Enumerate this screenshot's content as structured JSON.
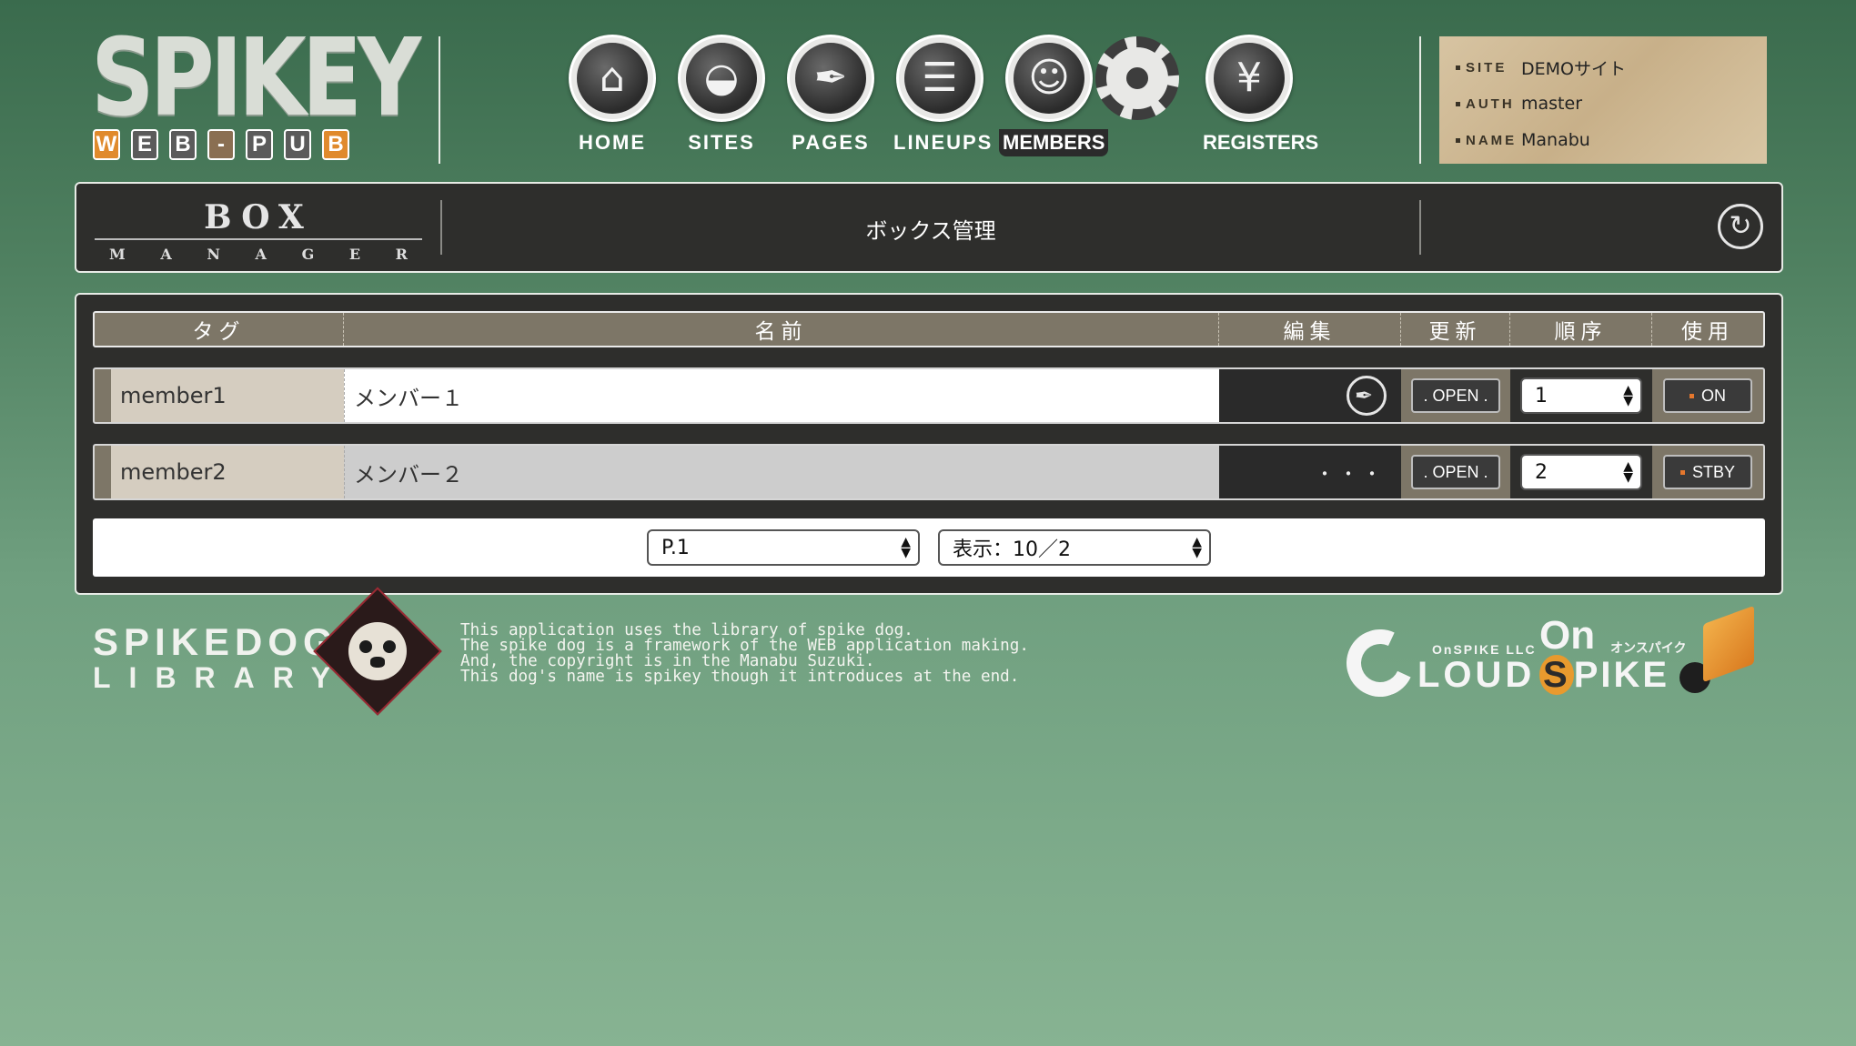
{
  "logo": {
    "title": "SPIKEY",
    "subtitle_chars": [
      "W",
      "E",
      "B",
      "-",
      "P",
      "U",
      "B"
    ],
    "subtitle_colors": [
      "#e08a2c",
      "#5b5b5b",
      "#5b5b5b",
      "#8a6f52",
      "#5b5b5b",
      "#5b5b5b",
      "#e08a2c"
    ]
  },
  "nav": {
    "items": [
      {
        "label": "HOME",
        "icon": "home-icon",
        "glyph": "⌂"
      },
      {
        "label": "SITES",
        "icon": "globe-icon",
        "glyph": "◒"
      },
      {
        "label": "PAGES",
        "icon": "pen-nib-icon",
        "glyph": "✒"
      },
      {
        "label": "LINEUPS",
        "icon": "stack-icon",
        "glyph": "☰"
      },
      {
        "label": "MEMBERS",
        "icon": "smiley-icon",
        "glyph": "☺"
      },
      {
        "label": "REGISTERS",
        "icon": "yen-icon",
        "glyph": "¥"
      }
    ],
    "active": "MEMBERS"
  },
  "info": {
    "site_key": "SITE",
    "site_value": "DEMOサイト",
    "auth_key": "AUTH",
    "auth_value": "master",
    "name_key": "NAME",
    "name_value": "Manabu"
  },
  "title_bar": {
    "box_word": "BOX",
    "manager_letters": [
      "M",
      "A",
      "N",
      "A",
      "G",
      "E",
      "R"
    ],
    "page_title": "ボックス管理",
    "refresh_icon": "refresh-icon"
  },
  "table": {
    "headers": {
      "tag": "タグ",
      "name": "名前",
      "edit": "編集",
      "update": "更新",
      "order": "順序",
      "use": "使用"
    },
    "rows": [
      {
        "tag": "member1",
        "name": "メンバー１",
        "edit": "edit-pen-icon",
        "open_label": ". OPEN .",
        "order": "1",
        "status": "ON",
        "active": true
      },
      {
        "tag": "member2",
        "name": "メンバー２",
        "edit_dots": "・・・",
        "open_label": ". OPEN .",
        "order": "2",
        "status": "STBY",
        "active": false
      }
    ]
  },
  "pager": {
    "page_select": "P.1",
    "display_select": "表示：10／2"
  },
  "footer": {
    "lib_top": "SPIKEDOG",
    "lib_bottom": "LIBRARY",
    "credit_lines": [
      "This application uses the library of spike dog.",
      "The spike dog is a framework of the WEB application making.",
      "And, the copyright is in the Manabu Suzuki.",
      "This dog's name is spikey though it introduces at the end."
    ],
    "cloud_small": "OnSPIKE LLC",
    "cloud_big": "LOUD",
    "on_big": "On",
    "on_kana": "オンスパイク",
    "spike_rest": "PIKE",
    "spike_s": "S"
  },
  "colors": {
    "accent_orange": "#e5772d",
    "panel_dark": "#2e2e2c",
    "header_brown": "#7d7667"
  }
}
